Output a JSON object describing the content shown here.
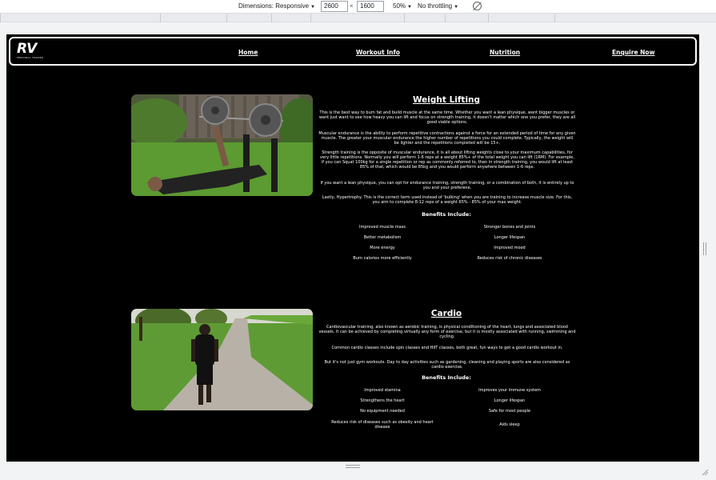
{
  "devtools": {
    "dimensions_label": "Dimensions: Responsive",
    "width_value": "2600",
    "times": "×",
    "height_value": "1600",
    "zoom": "50%",
    "throttling": "No throttling",
    "caret": "▼"
  },
  "nav": {
    "logo_text": "RV",
    "logo_sub": "PERSONAL TRAINER",
    "links": [
      "Home",
      "Workout Info",
      "Nutrition",
      "Enquire Now"
    ]
  },
  "weight": {
    "title": "Weight Lifting",
    "paragraphs": [
      "This is the best way to burn fat and build muscle at the same time. Whether you want a lean physique, want bigger muscles or want just want to see how heavy you can lift and focus on strength training, it doesn't matter which one you prefer, they are all good viable options.",
      "Muscular endurance is the ability to perform repetitive contractions against a force for an extended period of time for any given muscle. The greater your muscular endurance the higher number of repetitions you could complete. Typically, the weight will be lighter and the repetitions completed will be 15+.",
      "Strength training is the opposite of muscular endurance, it is all about lifting weights close to your maximum capabilities, for very little repetitions. Normally you will perform 1-6 reps at a weight 85%+ of the total weight you can lift (1RM). For example, if you can Squat 100kg for a single repetition or rep as commonly referred to, then in strength training, you would lift at least 85% of that, which would be 85kg and you would perform anywhere between 1-6 reps.",
      "If you want a lean physique, you can opt for endurance training, strength training, or a combination of both, it is entirely up to you and your preferene.",
      "Lastly, Hypertrophy. This is the correct term used instead of 'bulking' when you are training to increase muscle size. For this, you aim to complete 8-12 reps of a weight 65% - 85% of your max weight."
    ],
    "benefits_head": "Benefits Include:",
    "benefits_left": [
      "Improved muscle mass",
      "Better metabolism",
      "More energy",
      "Burn calories more efficiently"
    ],
    "benefits_right": [
      "Stronger bones and joints",
      "Longer lifespan",
      "Improved mood",
      "Reduces risk of chronic diseases"
    ]
  },
  "cardio": {
    "title": "Cardio",
    "paragraphs": [
      "Cardiovascular training, also known as aerobic training, is physical conditioning of the heart, lungs and associated blood vessels. It can be achieved by completing virtually any form of exercise, but it is mostly associated with running, swimming and cycling.",
      "Common cardio classes include spin classes and HIIT classes, both great, fun ways to get a good cardio workout in.",
      "But it's not just gym workouts. Day to day activities such as gardening, cleaning and playing sports are also considered as cardio exercise."
    ],
    "benefits_head": "Benefits Include:",
    "benefits_left": [
      "Improved stamina",
      "Strengthens the heart",
      "No equipment needed",
      "Reduces risk of diseases such as obesity and heart disease"
    ],
    "benefits_right": [
      "Improves your immune system",
      "Longer lifespan",
      "Safe for most people",
      "Aids sleep"
    ]
  }
}
